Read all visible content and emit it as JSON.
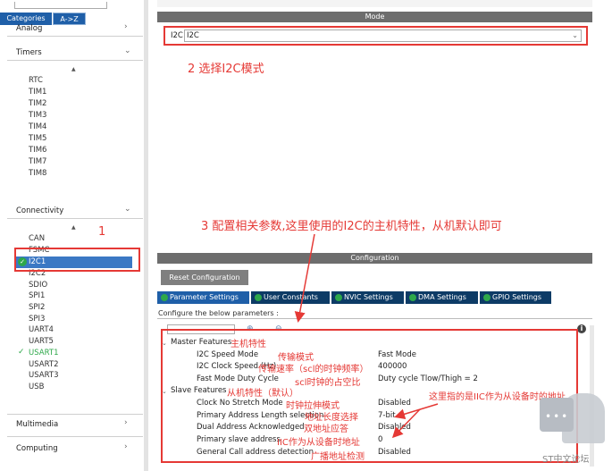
{
  "left_panel": {
    "tabs": [
      "Categories",
      "A->Z"
    ],
    "sections": {
      "analog": "Analog",
      "timers": "Timers",
      "connectivity": "Connectivity",
      "multimedia": "Multimedia",
      "computing": "Computing"
    },
    "timers_items": [
      "RTC",
      "TIM1",
      "TIM2",
      "TIM3",
      "TIM4",
      "TIM5",
      "TIM6",
      "TIM7",
      "TIM8"
    ],
    "connectivity_items": [
      "CAN",
      "FSMC",
      "I2C1",
      "I2C2",
      "SDIO",
      "SPI1",
      "SPI2",
      "SPI3",
      "UART4",
      "UART5",
      "USART1",
      "USART2",
      "USART3",
      "USB"
    ],
    "annotation": "1"
  },
  "mode": {
    "header": "Mode",
    "i2c_label": "I2C",
    "i2c_value": "I2C",
    "annotation": "2 选择I2C模式"
  },
  "annotation_3": "3 配置相关参数,这里使用的I2C的主机特性，从机默认即可",
  "configuration": {
    "header": "Configuration",
    "reset_button": "Reset Configuration",
    "tabs": [
      "Parameter Settings",
      "User Constants",
      "NVIC Settings",
      "DMA Settings",
      "GPIO Settings"
    ],
    "description": "Configure the below parameters :",
    "master_group": "Master Features",
    "master_group_cn": "主机特性",
    "master_params": [
      {
        "name": "I2C Speed Mode",
        "value": "Fast Mode",
        "cn": "传输模式"
      },
      {
        "name": "I2C Clock Speed (Hz)",
        "value": "400000",
        "cn": "传输速率（scl的时钟频率）"
      },
      {
        "name": "Fast Mode Duty Cycle",
        "value": "Duty cycle Tlow/Thigh = 2",
        "cn": "scl时钟的占空比"
      }
    ],
    "slave_group": "Slave Features",
    "slave_group_cn": "从机特性（默认）",
    "slave_params": [
      {
        "name": "Clock No Stretch Mode",
        "value": "Disabled",
        "cn": "时钟拉伸模式"
      },
      {
        "name": "Primary Address Length selection",
        "value": "7-bit",
        "cn": "地址长度选择"
      },
      {
        "name": "Dual Address Acknowledged",
        "value": "Disabled",
        "cn": "双地址应答"
      },
      {
        "name": "Primary slave address",
        "value": "0",
        "cn": "IIC作为从设备时地址"
      },
      {
        "name": "General Call address detection",
        "value": "Disabled",
        "cn": "广播地址检测"
      }
    ],
    "slave_note": "这里指的是IIC作为从设备时的地址"
  },
  "watermark": "ST中文论坛"
}
